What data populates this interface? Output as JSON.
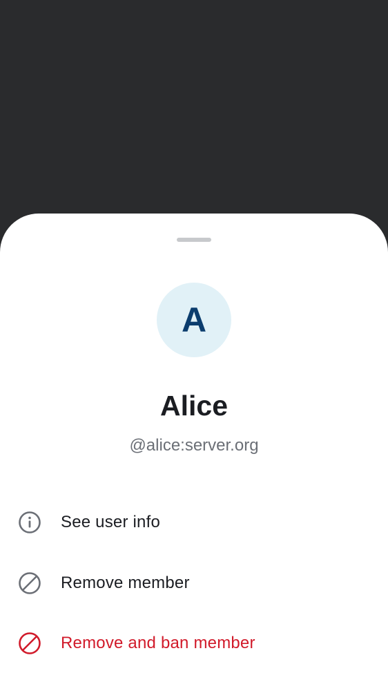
{
  "user": {
    "avatar_initial": "A",
    "display_name": "Alice",
    "user_id": "@alice:server.org"
  },
  "actions": [
    {
      "label": "See user info",
      "icon": "info-icon",
      "color": "#6b6f76"
    },
    {
      "label": "Remove member",
      "icon": "block-icon",
      "color": "#6b6f76"
    },
    {
      "label": "Remove and ban member",
      "icon": "ban-icon",
      "color": "#d11a2a"
    }
  ],
  "colors": {
    "scrim": "#2a2b2d",
    "sheet": "#ffffff",
    "avatar_bg": "#e1f1f7",
    "avatar_text": "#0b3d6e",
    "danger": "#d11a2a",
    "icon_gray": "#6b6f76"
  }
}
